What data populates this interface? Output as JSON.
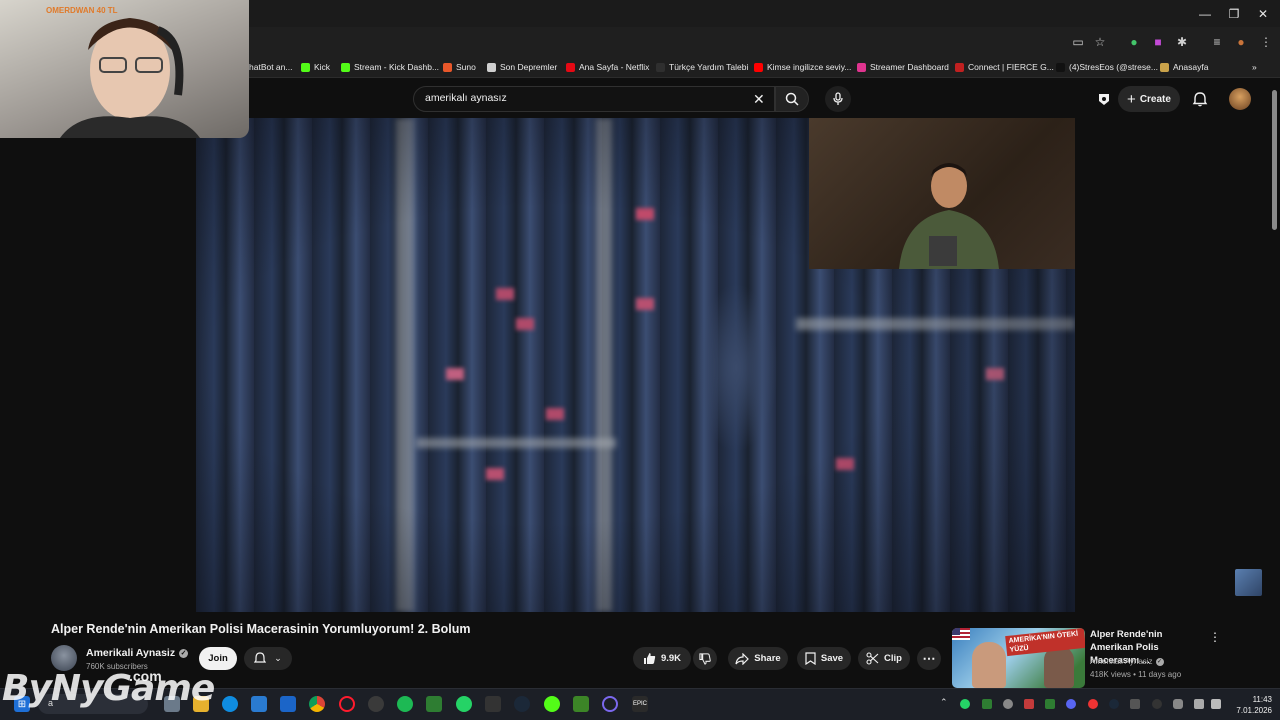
{
  "browser": {
    "bookmarks": [
      {
        "label": "hatBot an...",
        "color": "#2f2f2f"
      },
      {
        "label": "Kick",
        "color": "#53fc18"
      },
      {
        "label": "Stream - Kick Dashb...",
        "color": "#53fc18"
      },
      {
        "label": "Suno",
        "color": "#e8572a"
      },
      {
        "label": "Son Depremler",
        "color": "#cfcfcf"
      },
      {
        "label": "Ana Sayfa - Netflix",
        "color": "#e50914"
      },
      {
        "label": "Türkçe Yardım Talebi",
        "color": "#2f2f2f"
      },
      {
        "label": "Kimse ingilizce seviy...",
        "color": "#ff0000"
      },
      {
        "label": "Streamer Dashboard",
        "color": "#e0348f"
      },
      {
        "label": "Connect | FIERCE G...",
        "color": "#c02020"
      },
      {
        "label": "(4)StresEos (@strese...",
        "color": "#111111"
      },
      {
        "label": "Anasayfa",
        "color": "#c9a24a"
      }
    ],
    "overflow_glyph": "»"
  },
  "webcam": {
    "overlay_text": "OMERDWAN 40 TL"
  },
  "masthead": {
    "search_query": "amerikalı aynasız",
    "create_label": "Create"
  },
  "video": {
    "title": "Alper Rende'nin Amerikan Polisi Macerasinin Yorumluyorum! 2. Bolum",
    "channel_name": "Amerikali Aynasiz",
    "subscribers": "760K subscribers",
    "join_label": "Join",
    "likes": "9.9K",
    "share_label": "Share",
    "save_label": "Save",
    "clip_label": "Clip"
  },
  "recommendation": {
    "title": "Alper Rende'nin Amerikan Polis Macerasını ...",
    "channel": "Amerikali Aynasiz",
    "meta": "418K views • 11 days ago",
    "thumb_text": "AMERİKA'NIN ÖTEKİ YÜZÜ"
  },
  "taskbar": {
    "time": "11:43",
    "date": "7.01.2026",
    "search_placeholder": "a"
  },
  "watermark": {
    "text": "ByNyGame",
    "suffix": ".com"
  },
  "colors": {
    "background": "#0f0f0f",
    "accent_red": "#ff0000",
    "text": "#f1f1f1",
    "secondary_text": "#aaaaaa"
  }
}
